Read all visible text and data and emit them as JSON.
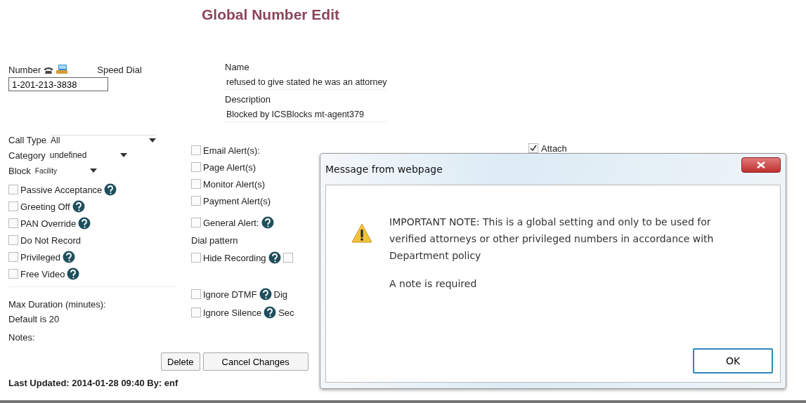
{
  "page": {
    "title": "Global Number Edit"
  },
  "number": {
    "label": "Number",
    "value": "1-201-213-3838"
  },
  "speed_dial": {
    "label": "Speed Dial"
  },
  "name": {
    "label": "Name",
    "value": "refused to  give stated he was an attorney"
  },
  "description": {
    "label": "Description",
    "value": "Blocked by ICSBlocks  mt-agent379"
  },
  "dropdowns": [
    {
      "label": "Call Type",
      "value": "All"
    },
    {
      "label": "Category",
      "value": "undefined"
    },
    {
      "label": "Block",
      "value": "Facility"
    }
  ],
  "options": [
    {
      "label": "Passive Acceptance",
      "checked": false,
      "help": true
    },
    {
      "label": "Greeting Off",
      "checked": false,
      "help": true
    },
    {
      "label": "PAN Override",
      "checked": false,
      "help": true
    },
    {
      "label": "Do Not Record",
      "checked": false,
      "help": false
    },
    {
      "label": "Privileged",
      "checked": false,
      "help": true
    },
    {
      "label": "Free Video",
      "checked": false,
      "help": true
    }
  ],
  "max_duration": {
    "label": "Max Duration (minutes):",
    "hint": "Default is 20"
  },
  "notes": {
    "label": "Notes:"
  },
  "alerts": [
    {
      "kind": "checkbox",
      "label": "Email Alert(s):",
      "checked": false,
      "help": false
    },
    {
      "kind": "checkbox",
      "label": "Page Alert(s)",
      "checked": false,
      "help": false
    },
    {
      "kind": "checkbox",
      "label": "Monitor Alert(s)",
      "checked": false,
      "help": false
    },
    {
      "kind": "checkbox",
      "label": "Payment Alert(s)",
      "checked": false,
      "help": false
    },
    {
      "kind": "checkbox",
      "label": "General Alert:",
      "checked": false,
      "help": true
    },
    {
      "kind": "heading",
      "label": "Dial pattern"
    },
    {
      "kind": "checkbox",
      "label": "Hide Recording",
      "checked": false,
      "help": true,
      "trailing_checkbox": {
        "checked": false
      }
    },
    {
      "kind": "checkbox",
      "label": "Ignore DTMF",
      "checked": false,
      "help": true,
      "trailing_text": "Dig"
    },
    {
      "kind": "checkbox",
      "label": "Ignore Silence",
      "checked": false,
      "help": true,
      "trailing_text": "Sec"
    }
  ],
  "attach": {
    "label": "Attach",
    "checked": true
  },
  "buttons": [
    {
      "label": "Delete"
    },
    {
      "label": "Cancel Changes"
    }
  ],
  "last_updated": "Last Updated: 2014-01-28 09:40 By: enf",
  "dialog": {
    "title": "Message from webpage",
    "message": "IMPORTANT NOTE: This is a global setting and only to be used for verified attorneys or other privileged numbers in accordance with Department policy",
    "note": "A note is required",
    "buttons": [
      "OK"
    ]
  }
}
